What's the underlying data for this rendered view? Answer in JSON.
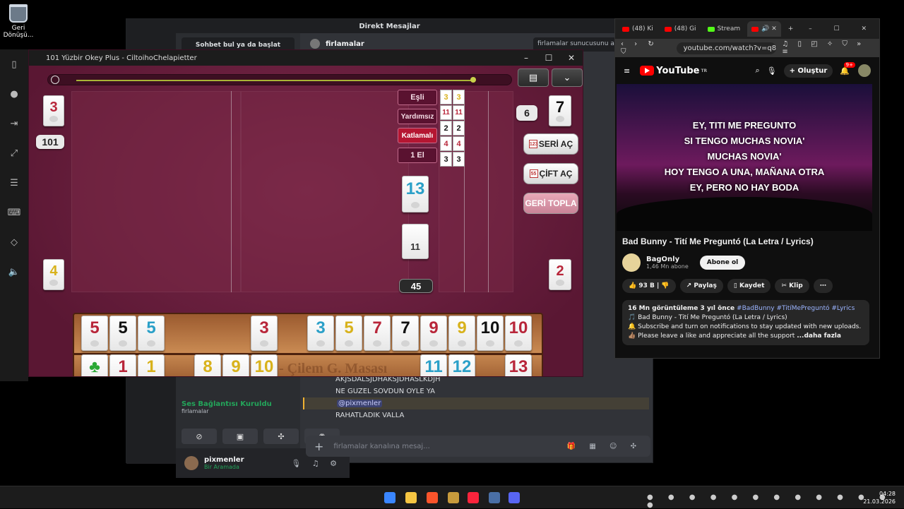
{
  "desktop": {
    "recycle_bin_label": "Geri Dönüşü..."
  },
  "discord": {
    "title": "Direkt Mesajlar",
    "search_placeholder": "Sohbet bul ya da başlat",
    "channel_name": "firlamalar",
    "top_search": "firlamalar sunucusunu ara",
    "voice_status": "Ses Bağlantısı Kuruldu",
    "voice_channel": "firlamalar",
    "user_name": "pixmenler",
    "user_status": "Bir Aramada",
    "messages": [
      "AKJSDALSJDHAKSJDHASLKDJH",
      "NE GUZEL SOVDUN OYLE YA",
      "@pixmenler",
      "RAHATLADIK VALLA"
    ],
    "input_placeholder": "firlamalar kanalına mesaj..."
  },
  "game": {
    "window_title": "101 Yüzbir Okey Plus - CiltoihoChelapietter",
    "left_top_tile": "3",
    "score_badge": "101",
    "left_bottom_tile": "4",
    "right_top_tile": "7",
    "right_top_badge": "6",
    "right_bottom_tile": "2",
    "center_tile": "13",
    "deck_tile": "11",
    "deck_count": "45",
    "mode_labels": [
      "Eşli",
      "Yardımsız",
      "Katlamalı",
      "1 El"
    ],
    "mode_tiles": [
      [
        "3",
        "3"
      ],
      [
        "11",
        "11"
      ],
      [
        "2",
        "2"
      ],
      [
        "4",
        "4"
      ],
      [
        "3",
        "3"
      ]
    ],
    "buttons": {
      "seri": "SERİ AÇ",
      "cift": "ÇİFT AÇ",
      "geri": "GERİ TOPLA"
    },
    "rack_text": "- Çilem G. Masası",
    "colors": {
      "red": "#b8263a",
      "black": "#111111",
      "blue": "#2ba0c8",
      "yellow": "#d8b21c",
      "green": "#2aa835"
    }
  },
  "rack_top": [
    {
      "v": "5",
      "c": "red"
    },
    {
      "v": "5",
      "c": "black"
    },
    {
      "v": "5",
      "c": "blue"
    },
    {
      "v": "3",
      "c": "red"
    },
    {
      "v": "3",
      "c": "blue"
    },
    {
      "v": "5",
      "c": "yellow"
    },
    {
      "v": "7",
      "c": "red"
    },
    {
      "v": "7",
      "c": "black"
    },
    {
      "v": "9",
      "c": "red"
    },
    {
      "v": "9",
      "c": "yellow"
    },
    {
      "v": "10",
      "c": "black"
    },
    {
      "v": "10",
      "c": "red"
    }
  ],
  "rack_bottom": [
    {
      "v": "♣",
      "c": "green"
    },
    {
      "v": "1",
      "c": "red"
    },
    {
      "v": "1",
      "c": "yellow"
    },
    {
      "v": "8",
      "c": "yellow"
    },
    {
      "v": "9",
      "c": "yellow"
    },
    {
      "v": "10",
      "c": "yellow"
    },
    {
      "v": "11",
      "c": "blue"
    },
    {
      "v": "12",
      "c": "blue"
    },
    {
      "v": "13",
      "c": "red"
    }
  ],
  "youtube": {
    "tabs": [
      "(48) Ki",
      "(48) Gi",
      "Stream",
      ""
    ],
    "url": "youtube.com/watch?v=q8",
    "logo": "YouTube",
    "logo_region": "TR",
    "create": "Oluştur",
    "notif_count": "9+",
    "lyrics": [
      "EY, TITI ME PREGUNTO",
      "SI TENGO MUCHAS NOVIA'",
      "MUCHAS NOVIA'",
      "HOY TENGO A UNA, MAÑANA OTRA",
      "EY, PERO NO HAY BODA"
    ],
    "video_title": "Bad Bunny - Tití Me Preguntó (La Letra / Lyrics)",
    "channel": "BagOnly",
    "subscribers": "1,46 Mn abone",
    "subscribe": "Abone ol",
    "likes": "93 B",
    "share": "Paylaş",
    "save": "Kaydet",
    "clip": "Klip",
    "views_line": "16 Mn görüntüleme  3 yıl önce",
    "tags": "#BadBunny #TitíMePreguntó #Lyrics",
    "desc1": "🎵 Bad Bunny - Tití Me Preguntó (La Letra / Lyrics)",
    "desc2": "🔔 Subscribe and turn on notifications to stay updated with new uploads.",
    "desc3": "👍🏽 Please leave a like and appreciate all the support",
    "more": "...daha fazla"
  },
  "taskbar": {
    "time": "04:28",
    "date": "21.03.2026"
  }
}
